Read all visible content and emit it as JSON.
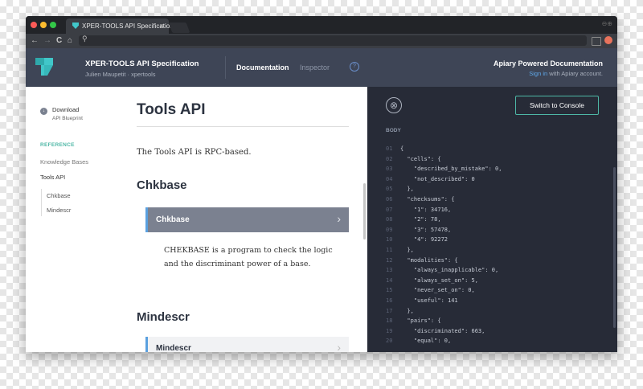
{
  "browser": {
    "tab_title": "XPER-TOOLS API Specification",
    "tab_close": "×",
    "nav_back": "←",
    "nav_forward": "→",
    "nav_reload": "C",
    "nav_home": "⌂",
    "address": "",
    "window_controls": "⊖⊕"
  },
  "header": {
    "app_title": "XPER-TOOLS API Specification",
    "app_sub": "Julien Maupetit · xpertools",
    "nav_documentation": "Documentation",
    "nav_inspector": "Inspector",
    "help": "?",
    "powered": "Apiary Powered Documentation",
    "signin_link": "Sign in",
    "signin_rest": " with Apiary account."
  },
  "sidebar": {
    "download_label": "Download",
    "download_sub": "API Blueprint",
    "reference": "REFERENCE",
    "knowledge_bases": "Knowledge Bases",
    "tools_api": "Tools API",
    "sub_items": [
      "Chkbase",
      "Mindescr"
    ]
  },
  "doc": {
    "title": "Tools API",
    "intro": "The Tools API is RPC-based.",
    "section1": "Chkbase",
    "resource1": "Chkbase",
    "resource1_desc": "CHEKBASE is a program to check the logic and the discriminant power of a base.",
    "section2": "Mindescr",
    "resource2": "Mindescr",
    "chevron": "›"
  },
  "console": {
    "close": "⊗",
    "switch_label": "Switch to Console",
    "body_label": "BODY",
    "lines": [
      {
        "n": "01",
        "t": "{"
      },
      {
        "n": "02",
        "t": "  \"cells\": {"
      },
      {
        "n": "03",
        "t": "    \"described_by_mistake\": 0,"
      },
      {
        "n": "04",
        "t": "    \"not_described\": 0"
      },
      {
        "n": "05",
        "t": "  },"
      },
      {
        "n": "06",
        "t": "  \"checksums\": {"
      },
      {
        "n": "07",
        "t": "    \"1\": 34716,"
      },
      {
        "n": "08",
        "t": "    \"2\": 78,"
      },
      {
        "n": "09",
        "t": "    \"3\": 57478,"
      },
      {
        "n": "10",
        "t": "    \"4\": 92272"
      },
      {
        "n": "11",
        "t": "  },"
      },
      {
        "n": "12",
        "t": "  \"modalities\": {"
      },
      {
        "n": "13",
        "t": "    \"always_inapplicable\": 0,"
      },
      {
        "n": "14",
        "t": "    \"always_set_on\": 5,"
      },
      {
        "n": "15",
        "t": "    \"never_set_on\": 0,"
      },
      {
        "n": "16",
        "t": "    \"useful\": 141"
      },
      {
        "n": "17",
        "t": "  },"
      },
      {
        "n": "18",
        "t": "  \"pairs\": {"
      },
      {
        "n": "19",
        "t": "    \"discriminated\": 663,"
      },
      {
        "n": "20",
        "t": "    \"equal\": 0,"
      }
    ]
  },
  "colors": {
    "accent": "#4eb7a6",
    "header_bg": "#3e4556",
    "console_bg": "#272b37",
    "resource_bg": "#7b8190",
    "link": "#5fa8e8"
  }
}
